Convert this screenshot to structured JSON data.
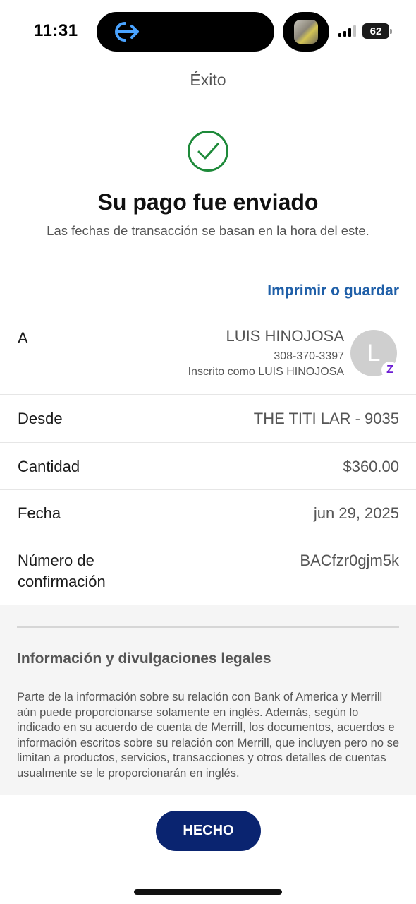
{
  "status_bar": {
    "time": "11:31",
    "battery": "62",
    "island_icon": "screen-share-arrow-icon"
  },
  "header": {
    "title": "Éxito"
  },
  "confirmation": {
    "icon": "check-circle-icon",
    "headline": "Su pago fue enviado",
    "subline": "Las fechas de transacción se basan en la hora del este.",
    "print_label": "Imprimir o guardar"
  },
  "details": {
    "to": {
      "label": "A",
      "name": "LUIS HINOJOSA",
      "phone": "308-370-3397",
      "enrolled_as": "Inscrito como LUIS HINOJOSA",
      "avatar_initial": "L",
      "badge": "Z"
    },
    "from": {
      "label": "Desde",
      "value": "THE TITI LAR - 9035"
    },
    "amount": {
      "label": "Cantidad",
      "value": "$360.00"
    },
    "date": {
      "label": "Fecha",
      "value": "jun 29, 2025"
    },
    "confirmation_number": {
      "label": "Número de confirmación",
      "value": "BACfzr0gjm5k"
    }
  },
  "legal": {
    "title": "Información y divulgaciones legales",
    "body": "Parte de la información sobre su relación con Bank of America y Merrill aún puede proporcionarse solamente en inglés. Además, según lo indicado en su acuerdo de cuenta de Merrill, los documentos, acuerdos e información escritos sobre su relación con Merrill, que incluyen pero no se limitan a productos, servicios, transacciones y otros detalles de cuentas usualmente se le proporcionarán en inglés."
  },
  "done_label": "HECHO",
  "colors": {
    "accent_link": "#1f5fa8",
    "success_green": "#1e8a3a",
    "primary_button": "#0a2470",
    "zelle_purple": "#6d1ed4"
  }
}
